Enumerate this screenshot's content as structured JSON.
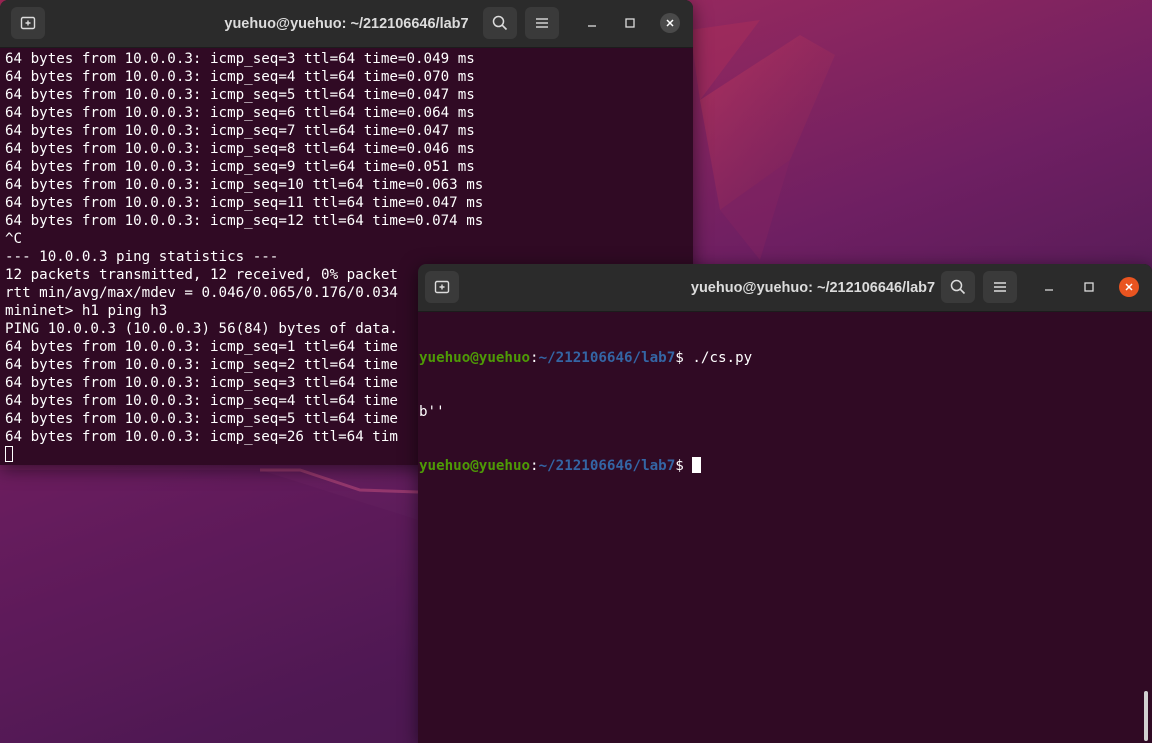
{
  "wallpaper": {
    "colors": [
      "#a8295a",
      "#6e1f62",
      "#3a1442"
    ]
  },
  "window_back": {
    "title": "yuehuo@yuehuo: ~/212106646/lab7",
    "new_tab_icon": "new-tab-icon",
    "search_icon": "search-icon",
    "menu_icon": "hamburger-menu-icon",
    "minimize_icon": "minimize-icon",
    "maximize_icon": "maximize-icon",
    "close_icon": "close-icon",
    "lines": [
      "64 bytes from 10.0.0.3: icmp_seq=3 ttl=64 time=0.049 ms",
      "64 bytes from 10.0.0.3: icmp_seq=4 ttl=64 time=0.070 ms",
      "64 bytes from 10.0.0.3: icmp_seq=5 ttl=64 time=0.047 ms",
      "64 bytes from 10.0.0.3: icmp_seq=6 ttl=64 time=0.064 ms",
      "64 bytes from 10.0.0.3: icmp_seq=7 ttl=64 time=0.047 ms",
      "64 bytes from 10.0.0.3: icmp_seq=8 ttl=64 time=0.046 ms",
      "64 bytes from 10.0.0.3: icmp_seq=9 ttl=64 time=0.051 ms",
      "64 bytes from 10.0.0.3: icmp_seq=10 ttl=64 time=0.063 ms",
      "64 bytes from 10.0.0.3: icmp_seq=11 ttl=64 time=0.047 ms",
      "64 bytes from 10.0.0.3: icmp_seq=12 ttl=64 time=0.074 ms",
      "^C",
      "--- 10.0.0.3 ping statistics ---",
      "12 packets transmitted, 12 received, 0% packet",
      "rtt min/avg/max/mdev = 0.046/0.065/0.176/0.034",
      "mininet> h1 ping h3",
      "PING 10.0.0.3 (10.0.0.3) 56(84) bytes of data.",
      "64 bytes from 10.0.0.3: icmp_seq=1 ttl=64 time",
      "64 bytes from 10.0.0.3: icmp_seq=2 ttl=64 time",
      "64 bytes from 10.0.0.3: icmp_seq=3 ttl=64 time",
      "64 bytes from 10.0.0.3: icmp_seq=4 ttl=64 time",
      "64 bytes from 10.0.0.3: icmp_seq=5 ttl=64 time",
      "64 bytes from 10.0.0.3: icmp_seq=26 ttl=64 tim"
    ]
  },
  "window_front": {
    "title": "yuehuo@yuehuo: ~/212106646/lab7",
    "new_tab_icon": "new-tab-icon",
    "search_icon": "search-icon",
    "menu_icon": "hamburger-menu-icon",
    "minimize_icon": "minimize-icon",
    "maximize_icon": "maximize-icon",
    "close_icon": "close-icon",
    "prompt_user": "yuehuo@yuehuo",
    "prompt_sep": ":",
    "prompt_path": "~/212106646/lab7",
    "prompt_symbol": "$ ",
    "command1": "./cs.py",
    "output1": "b''",
    "command2": ""
  },
  "colors": {
    "terminal_bg": "#300a24",
    "titlebar_bg": "#2b2b2b",
    "prompt_user": "#4e9a06",
    "prompt_path": "#3465a4",
    "close_active": "#e95420",
    "close_inactive": "#4a4a4a"
  }
}
